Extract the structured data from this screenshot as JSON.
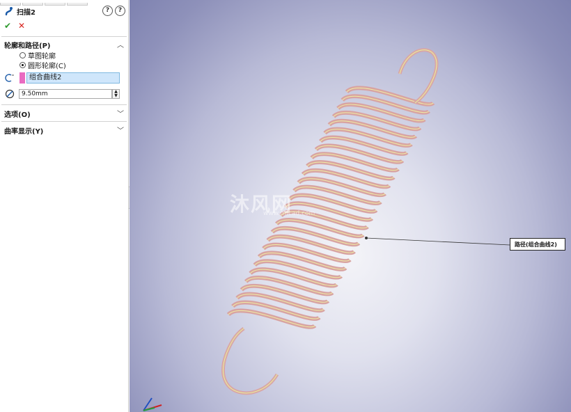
{
  "feature": {
    "title": "扫描2",
    "help_icon": "question-plus-icon",
    "help2_icon": "question-icon",
    "ok_icon": "checkmark",
    "cancel_icon": "x-mark"
  },
  "profile_path": {
    "header": "轮廓和路径(P)",
    "options": [
      {
        "label": "草图轮廓",
        "selected": false
      },
      {
        "label": "圆形轮廓(C)",
        "selected": true
      }
    ],
    "path_selection": "组合曲线2",
    "path_color": "#e96cc1",
    "diameter": "9.50mm"
  },
  "sections": [
    {
      "label": "选项(O)"
    },
    {
      "label": "曲率显示(Y)"
    }
  ],
  "viewport": {
    "callout": "路径(组合曲线2)",
    "watermark": "沐风网",
    "watermark_url": "www.mfcad.com"
  }
}
